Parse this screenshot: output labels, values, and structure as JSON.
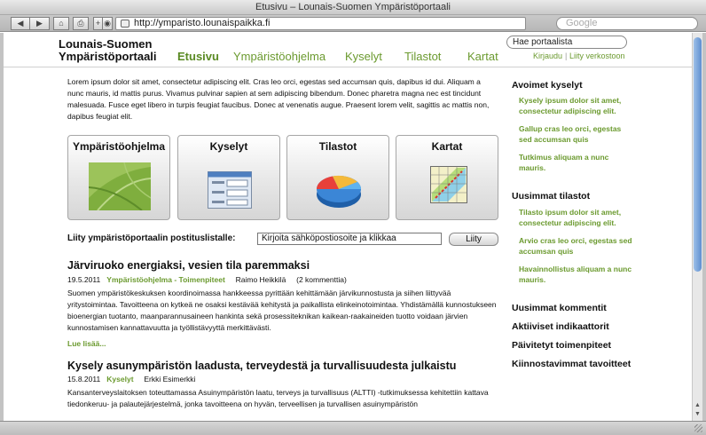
{
  "browser": {
    "window_title": "Etusivu – Lounais-Suomen Ympäristöportaali",
    "url": "http://ymparisto.lounaispaikka.fi",
    "search_placeholder": "Google",
    "back_label": "◀",
    "forward_label": "▶",
    "home_label": "⌂",
    "print_label": "⎙",
    "add_label": "+",
    "snapback_label": "◉"
  },
  "site": {
    "title_line1": "Lounais-Suomen",
    "title_line2": "Ympäristöportaali",
    "nav": [
      "Etusivu",
      "Ympäristöohjelma",
      "Kyselyt",
      "Tilastot",
      "Kartat"
    ],
    "search_value": "Hae portaalista",
    "login_label": "Kirjaudu",
    "join_label": "Liity verkostoon",
    "separator": "|"
  },
  "intro": "Lorem ipsum dolor sit amet, consectetur adipiscing elit. Cras leo orci, egestas sed accumsan quis, dapibus id dui. Aliquam a nunc mauris, id mattis purus. Vivamus pulvinar sapien at sem adipiscing bibendum. Donec pharetra magna nec est tincidunt malesuada. Fusce eget libero in turpis feugiat faucibus. Donec at venenatis augue. Praesent lorem velit, sagittis ac mattis non, dapibus feugiat elit.",
  "cards": [
    {
      "label": "Ympäristöohjelma",
      "icon": "leaf-photo-icon"
    },
    {
      "label": "Kyselyt",
      "icon": "form-icon"
    },
    {
      "label": "Tilastot",
      "icon": "pie-chart-icon"
    },
    {
      "label": "Kartat",
      "icon": "map-icon"
    }
  ],
  "newsletter": {
    "label": "Liity ympäristöportaalin postituslistalle:",
    "input_value": "Kirjoita sähköpostiosoite ja klikkaa",
    "button_label": "Liity"
  },
  "articles": [
    {
      "title": "Järviruoko energiaksi, vesien tila paremmaksi",
      "date": "19.5.2011",
      "category": "Ympäristöohjelma - Toimenpiteet",
      "author": "Raimo Heikkilä",
      "comments": "(2 kommenttia)",
      "body": "Suomen ympäristökeskuksen koordinoimassa hankkeessa pyrittään kehittämään järvikunnostusta ja siihen liittyvää yritystoimintaa. Tavoitteena on kytkeä ne osaksi kestävää kehitystä ja paikallista elinkeinotoimintaa. Yhdistämällä kunnostukseen bioenergian tuotanto, maanparannusaineen hankinta sekä prosessiteknikan kaikean-raakaineiden tuotto voidaan järvien kunnostamisen kannattavuutta ja työllistävyyttä merkittävästi.",
      "read_more": "Lue lisää..."
    },
    {
      "title": "Kysely asunympäristön laadusta, terveydestä ja turvallisuudesta julkaistu",
      "date": "15.8.2011",
      "category": "Kyselyt",
      "author": "Erkki Esimerkki",
      "comments": "",
      "body": "Kansanterveyslaitoksen toteuttamassa Asuinympäristön laatu, terveys ja turvallisuus (ALTTI) -tutkimuksessa kehitettiin kattava tiedonkeruu- ja palautejärjestelmä, jonka tavoitteena on hyvän, terveellisen ja turvallisen asuinympäristön",
      "read_more": ""
    }
  ],
  "sidebar": {
    "open_surveys_title": "Avoimet kyselyt",
    "open_surveys": [
      "Kysely ipsum dolor sit amet, consectetur adipiscing elit.",
      "Gallup cras leo orci, egestas sed accumsan quis",
      "Tutkimus aliquam a nunc mauris."
    ],
    "latest_stats_title": "Uusimmat tilastot",
    "latest_stats": [
      "Tilasto ipsum dolor sit amet, consectetur adipiscing elit.",
      "Arvio cras leo orci, egestas sed accumsan quis",
      "Havainnollistus aliquam a nunc mauris."
    ],
    "more_headings": [
      "Uusimmat kommentit",
      "Aktiiviset indikaattorit",
      "Päivitetyt toimenpiteet",
      "Kiinnostavimmat tavoitteet"
    ]
  },
  "colors": {
    "accent_green": "#6b9a2f",
    "thumb_blue": "#5e8fd0"
  }
}
